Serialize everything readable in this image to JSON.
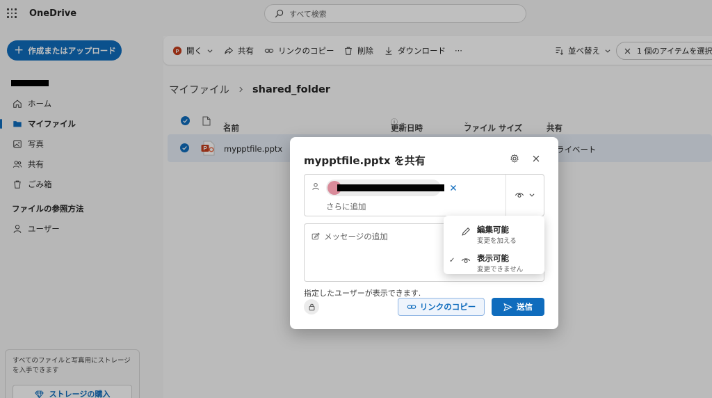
{
  "header": {
    "app_name": "OneDrive",
    "search_placeholder": "すべて検索"
  },
  "sidebar": {
    "create_button": "作成またはアップロード",
    "items": [
      {
        "label": "ホーム",
        "icon": "home-icon"
      },
      {
        "label": "マイファイル",
        "icon": "folder-icon",
        "active": true
      },
      {
        "label": "写真",
        "icon": "image-icon"
      },
      {
        "label": "共有",
        "icon": "people-icon"
      },
      {
        "label": "ごみ箱",
        "icon": "trash-icon"
      }
    ],
    "browse_heading": "ファイルの参照方法",
    "browse_items": [
      {
        "label": "ユーザー",
        "icon": "person-icon"
      }
    ],
    "storage_text": "すべてのファイルと写真用にストレージを入手できます",
    "storage_button": "ストレージの購入"
  },
  "toolbar": {
    "open": "開く",
    "share": "共有",
    "copy_link": "リンクのコピー",
    "delete": "削除",
    "download": "ダウンロード",
    "more": "···",
    "sort": "並べ替え",
    "selection": "1 個のアイテムを選択"
  },
  "breadcrumb": {
    "root": "マイファイル",
    "current": "shared_folder"
  },
  "list": {
    "columns": {
      "name": "名前",
      "modified": "更新日時",
      "size": "ファイル サイズ",
      "sharing": "共有"
    },
    "rows": [
      {
        "name": "mypptfile.pptx",
        "sharing": "ライベート"
      }
    ]
  },
  "dialog": {
    "title": "mypptfile.pptx を共有",
    "add_more": "さらに追加",
    "message_placeholder": "メッセージの追加",
    "info": "指定したユーザーが表示できます.",
    "copy_link": "リンクのコピー",
    "send": "送信"
  },
  "permission_menu": {
    "items": [
      {
        "label": "編集可能",
        "sub": "変更を加える",
        "icon": "pencil-icon",
        "checked": false
      },
      {
        "label": "表示可能",
        "sub": "変更できません",
        "icon": "eye-icon",
        "checked": true
      }
    ]
  },
  "colors": {
    "accent": "#0f6cbd",
    "powerpoint": "#c43e1c"
  }
}
